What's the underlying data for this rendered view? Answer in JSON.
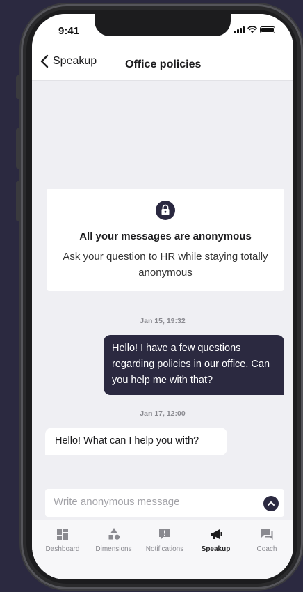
{
  "status": {
    "time": "9:41"
  },
  "nav": {
    "back_label": "Speakup",
    "title": "Office policies"
  },
  "notice": {
    "title": "All your messages are anonymous",
    "text": "Ask your question to HR while staying totally anonymous"
  },
  "messages": [
    {
      "timestamp": "Jan 15, 19:32",
      "direction": "outgoing",
      "text": "Hello! I have a few questions regarding policies in our office. Can you help me with that?"
    },
    {
      "timestamp": "Jan 17, 12:00",
      "direction": "incoming",
      "text": "Hello! What can I help you with?"
    }
  ],
  "composer": {
    "placeholder": "Write anonymous message",
    "value": ""
  },
  "tabs": [
    {
      "label": "Dashboard",
      "icon": "dashboard-icon",
      "active": false
    },
    {
      "label": "Dimensions",
      "icon": "dimensions-icon",
      "active": false
    },
    {
      "label": "Notifications",
      "icon": "notifications-icon",
      "active": false
    },
    {
      "label": "Speakup",
      "icon": "megaphone-icon",
      "active": true
    },
    {
      "label": "Coach",
      "icon": "coach-chat-icon",
      "active": false
    }
  ],
  "colors": {
    "accent": "#2b2940",
    "background": "#efeff3",
    "inactive": "#8a8a90"
  }
}
